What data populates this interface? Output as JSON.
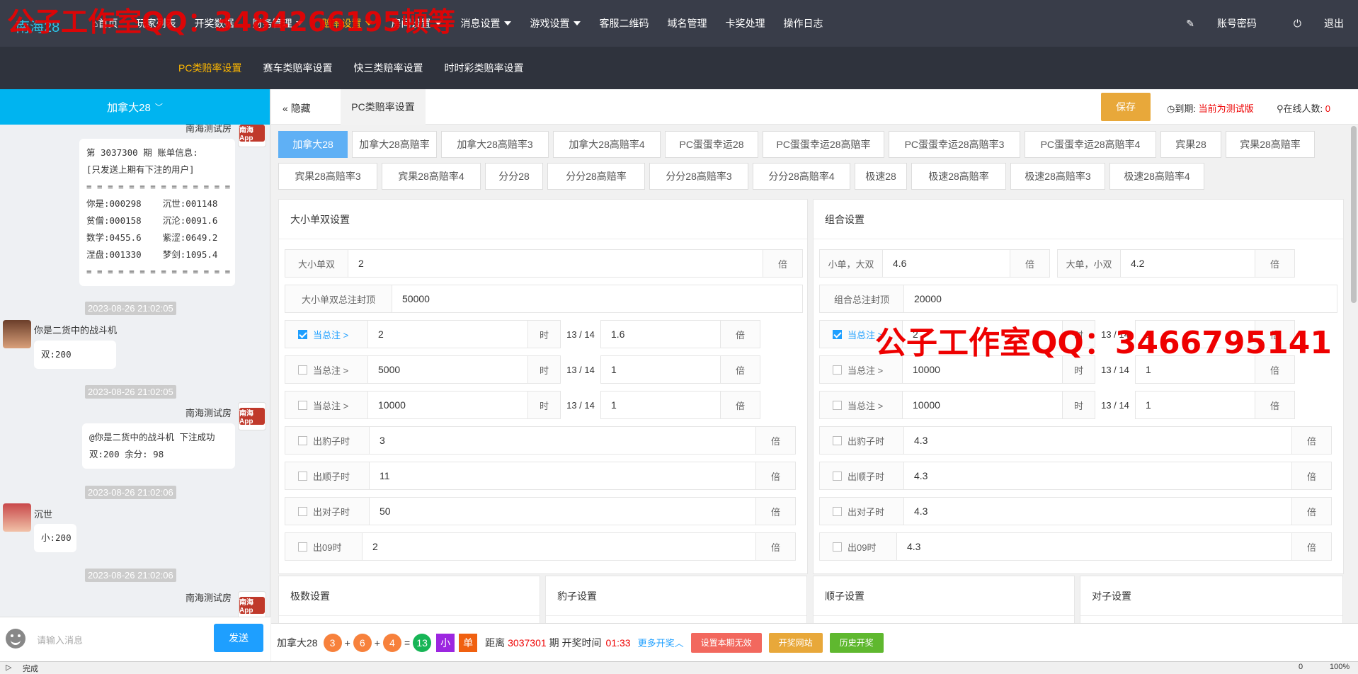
{
  "watermark_top": "公子工作室QQ：3484266195顿等",
  "watermark_mid": "公子工作室QQ：3466795141",
  "brand": "南海28",
  "topnav": [
    {
      "label": "首页",
      "caret": false,
      "active": false
    },
    {
      "label": "玩家列表",
      "caret": false,
      "active": false
    },
    {
      "label": "开奖数据",
      "caret": false,
      "active": false
    },
    {
      "label": "财务管理",
      "caret": true,
      "active": false
    },
    {
      "label": "赔率设置",
      "caret": true,
      "active": true
    },
    {
      "label": "房间设置",
      "caret": true,
      "active": false
    },
    {
      "label": "消息设置",
      "caret": true,
      "active": false
    },
    {
      "label": "游戏设置",
      "caret": true,
      "active": false
    },
    {
      "label": "客服二维码",
      "caret": false,
      "active": false
    },
    {
      "label": "域名管理",
      "caret": false,
      "active": false
    },
    {
      "label": "卡奖处理",
      "caret": false,
      "active": false
    },
    {
      "label": "操作日志",
      "caret": false,
      "active": false
    }
  ],
  "topright": {
    "account": "账号密码",
    "logout": "退出"
  },
  "subnav": [
    "PC类赔率设置",
    "赛车类赔率设置",
    "快三类赔率设置",
    "时时彩类赔率设置"
  ],
  "left": {
    "room": "加拿大28",
    "messages": {
      "room_name": "南海测试房",
      "bill": "第 3037300 期 账单信息:\n[只发送上期有下注的用户]\n= = = = = = = = = = = = = =\n你是:000298    沉世:001148\n贫僧:000158    沉沦:0091.6\n数学:0455.6    紫涩:0649.2\n涅盘:001330    梦剑:1095.4\n= = = = = = = = = = = = = =",
      "t1": "2023-08-26 21:02:05",
      "user1": "你是二货中的战斗机",
      "bet1": "双:200",
      "t2": "2023-08-26 21:02:05",
      "reply1": "@你是二货中的战斗机 下注成功\n双:200 余分: 98",
      "t3": "2023-08-26 21:02:06",
      "user2": "沉世",
      "bet2": "小:200",
      "t4": "2023-08-26 21:02:06",
      "logo": "南海App"
    },
    "input_placeholder": "请输入消息",
    "send": "发送"
  },
  "main": {
    "hide": "隐藏",
    "tab": "PC类赔率设置",
    "save": "保存",
    "expire_label": "到期:",
    "expire_value": "当前为测试版",
    "online_label": "在线人数:",
    "online_value": "0",
    "game_tabs_row1": [
      "加拿大28",
      "加拿大28高赔率",
      "加拿大28高赔率3",
      "加拿大28高赔率4",
      "PC蛋蛋幸运28",
      "PC蛋蛋幸运28高赔率",
      "PC蛋蛋幸运28高赔率3",
      "PC蛋蛋幸运28高赔率4",
      "宾果28",
      "宾果28高赔率"
    ],
    "game_tabs_row2": [
      "宾果28高赔率3",
      "宾果28高赔率4",
      "分分28",
      "分分28高赔率",
      "分分28高赔率3",
      "分分28高赔率4",
      "极速28",
      "极速28高赔率",
      "极速28高赔率3",
      "极速28高赔率4"
    ],
    "panel_left": {
      "title": "大小单双设置",
      "r1_label": "大小单双",
      "r1_value": "2",
      "r2_label": "大小单双总注封顶",
      "r2_value": "50000",
      "cond": [
        {
          "checked": true,
          "label": "当总注 >",
          "value": "2",
          "when": "时",
          "mid": "13 / 14",
          "odds": "1.6"
        },
        {
          "checked": false,
          "label": "当总注 >",
          "value": "5000",
          "when": "时",
          "mid": "13 / 14",
          "odds": "1"
        },
        {
          "checked": false,
          "label": "当总注 >",
          "value": "10000",
          "when": "时",
          "mid": "13 / 14",
          "odds": "1"
        }
      ],
      "extra": [
        {
          "label": "出豹子时",
          "value": "3"
        },
        {
          "label": "出顺子时",
          "value": "11"
        },
        {
          "label": "出对子时",
          "value": "50"
        },
        {
          "label": "出09时",
          "value": "2"
        }
      ]
    },
    "panel_right": {
      "title": "组合设置",
      "r1a_label": "小单，大双",
      "r1a_value": "4.6",
      "r1b_label": "大单，小双",
      "r1b_value": "4.2",
      "r2_label": "组合总注封顶",
      "r2_value": "20000",
      "cond": [
        {
          "checked": true,
          "label": "当总注 >",
          "value": "2",
          "when": "时",
          "mid": "13 / 14",
          "odds": "1"
        },
        {
          "checked": false,
          "label": "当总注 >",
          "value": "10000",
          "when": "时",
          "mid": "13 / 14",
          "odds": "1"
        },
        {
          "checked": false,
          "label": "当总注 >",
          "value": "10000",
          "when": "时",
          "mid": "13 / 14",
          "odds": "1"
        }
      ],
      "extra": [
        {
          "label": "出豹子时",
          "value": "4.3"
        },
        {
          "label": "出顺子时",
          "value": "4.3"
        },
        {
          "label": "出对子时",
          "value": "4.3"
        },
        {
          "label": "出09时",
          "value": "4.3"
        }
      ]
    },
    "unit": "倍",
    "lower_panels": [
      "极数设置",
      "豹子设置",
      "顺子设置",
      "对子设置"
    ]
  },
  "bottom": {
    "game": "加拿大28",
    "n1": "3",
    "n2": "6",
    "n3": "4",
    "sum": "13",
    "tag1": "小",
    "tag2": "单",
    "dist_label": "距离",
    "period": "3037301",
    "period_label": "期 开奖时间",
    "time": "01:33",
    "more": "更多开奖",
    "btn1": "设置本期无效",
    "btn2": "开奖网站",
    "btn3": "历史开奖"
  },
  "statusbar": {
    "text": "完成",
    "zoom": "100%",
    "count": "0"
  },
  "colors": {
    "topbar": "#393d49",
    "accent": "#ffb800",
    "blue": "#1e9fff",
    "cyan": "#00b4f0"
  }
}
